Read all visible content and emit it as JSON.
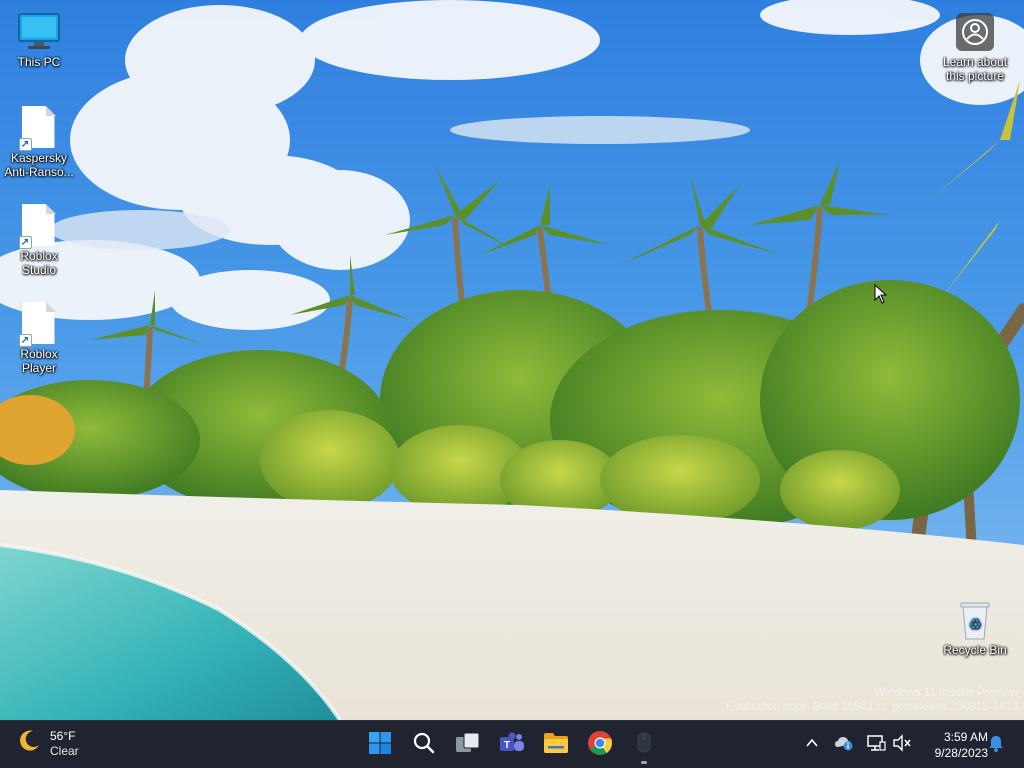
{
  "desktop": {
    "icons": [
      {
        "label": "This PC",
        "icon": "monitor-icon"
      },
      {
        "label": "Kaspersky Anti-Ranso...",
        "icon": "file-shortcut-icon"
      },
      {
        "label": "Roblox Studio",
        "icon": "file-shortcut-icon"
      },
      {
        "label": "Roblox Player",
        "icon": "file-shortcut-icon"
      },
      {
        "label": "Learn about this picture",
        "icon": "camera-circle-icon"
      },
      {
        "label": "Recycle Bin",
        "icon": "recycle-bin-icon"
      }
    ]
  },
  "watermark": {
    "line1": "Windows 11 Insider Preview",
    "line2": "Evaluation copy. Build 25951.rs_prerelease.230915-1413"
  },
  "taskbar": {
    "weather": {
      "temperature": "56°F",
      "condition": "Clear",
      "icon": "moon-icon"
    },
    "apps": [
      {
        "name": "Start",
        "icon": "windows-start-icon"
      },
      {
        "name": "Search",
        "icon": "search-icon"
      },
      {
        "name": "Task View",
        "icon": "task-view-icon"
      },
      {
        "name": "Microsoft Teams",
        "icon": "teams-icon"
      },
      {
        "name": "File Explorer",
        "icon": "file-explorer-icon"
      },
      {
        "name": "Google Chrome",
        "icon": "chrome-icon"
      },
      {
        "name": "Mouse app",
        "icon": "mouse-icon"
      }
    ],
    "tray": {
      "time": "3:59 AM",
      "date": "9/28/2023"
    }
  },
  "colors": {
    "taskbar_bg": "#1f2430",
    "start_blue": "#1e90ff",
    "accent_blue": "#3a8ee6"
  }
}
